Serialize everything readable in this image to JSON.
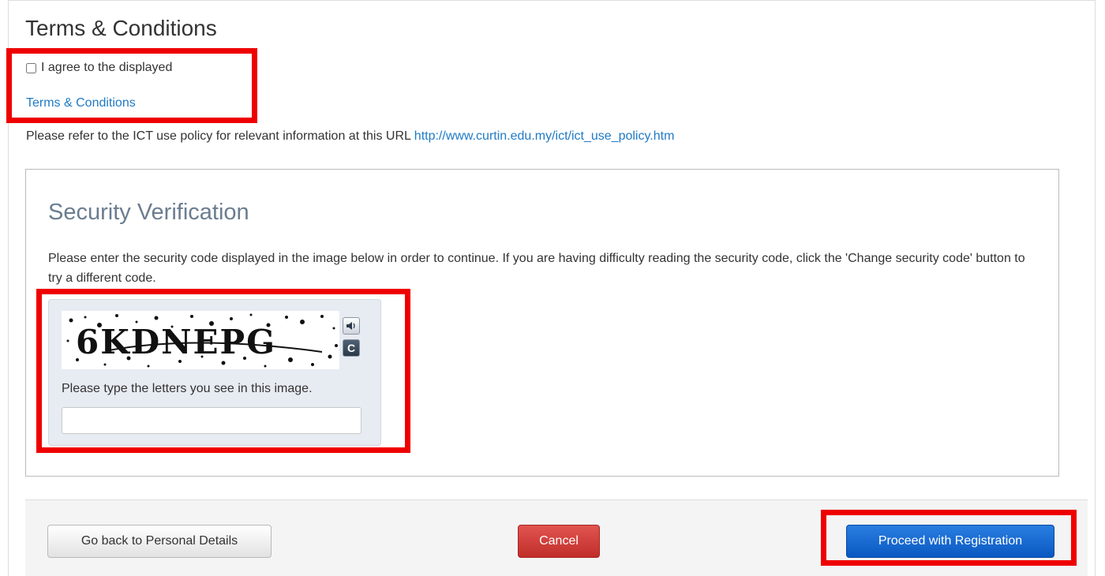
{
  "terms": {
    "title": "Terms & Conditions",
    "agree_label": "I agree to the displayed",
    "agree_checked": false,
    "terms_link": "Terms & Conditions",
    "policy_text": "Please refer to the ICT use policy for relevant information at this URL",
    "policy_url": "http://www.curtin.edu.my/ict/ict_use_policy.htm"
  },
  "security": {
    "title": "Security Verification",
    "description": "Please enter the security code displayed in the image below in order to continue. If you are having difficulty reading the security code, click the 'Change security code' button to try a different code.",
    "captcha_text": "6KDNEPG",
    "audio_icon": "speaker-icon",
    "refresh_icon": "refresh-icon",
    "input_label": "Please type the letters you see in this image.",
    "input_value": ""
  },
  "footer": {
    "back_label": "Go back to Personal Details",
    "cancel_label": "Cancel",
    "proceed_label": "Proceed with Registration"
  },
  "colors": {
    "link": "#1f7ac5",
    "highlight": "#ee0000",
    "cancel": "#c9302c",
    "primary": "#0d62d0"
  }
}
